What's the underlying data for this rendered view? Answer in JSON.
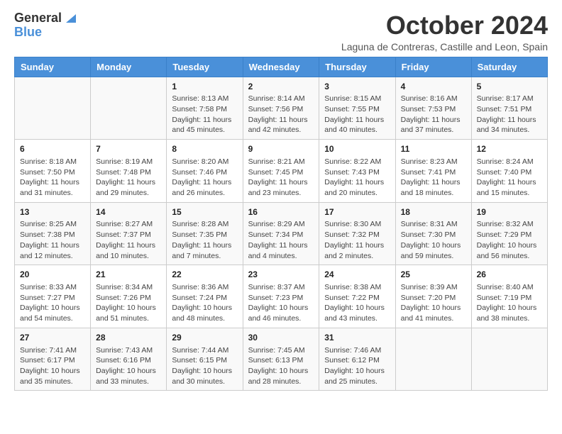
{
  "header": {
    "logo_line1": "General",
    "logo_line2": "Blue",
    "month_title": "October 2024",
    "location": "Laguna de Contreras, Castille and Leon, Spain"
  },
  "weekdays": [
    "Sunday",
    "Monday",
    "Tuesday",
    "Wednesday",
    "Thursday",
    "Friday",
    "Saturday"
  ],
  "weeks": [
    [
      {
        "day": "",
        "content": ""
      },
      {
        "day": "",
        "content": ""
      },
      {
        "day": "1",
        "content": "Sunrise: 8:13 AM\nSunset: 7:58 PM\nDaylight: 11 hours and 45 minutes."
      },
      {
        "day": "2",
        "content": "Sunrise: 8:14 AM\nSunset: 7:56 PM\nDaylight: 11 hours and 42 minutes."
      },
      {
        "day": "3",
        "content": "Sunrise: 8:15 AM\nSunset: 7:55 PM\nDaylight: 11 hours and 40 minutes."
      },
      {
        "day": "4",
        "content": "Sunrise: 8:16 AM\nSunset: 7:53 PM\nDaylight: 11 hours and 37 minutes."
      },
      {
        "day": "5",
        "content": "Sunrise: 8:17 AM\nSunset: 7:51 PM\nDaylight: 11 hours and 34 minutes."
      }
    ],
    [
      {
        "day": "6",
        "content": "Sunrise: 8:18 AM\nSunset: 7:50 PM\nDaylight: 11 hours and 31 minutes."
      },
      {
        "day": "7",
        "content": "Sunrise: 8:19 AM\nSunset: 7:48 PM\nDaylight: 11 hours and 29 minutes."
      },
      {
        "day": "8",
        "content": "Sunrise: 8:20 AM\nSunset: 7:46 PM\nDaylight: 11 hours and 26 minutes."
      },
      {
        "day": "9",
        "content": "Sunrise: 8:21 AM\nSunset: 7:45 PM\nDaylight: 11 hours and 23 minutes."
      },
      {
        "day": "10",
        "content": "Sunrise: 8:22 AM\nSunset: 7:43 PM\nDaylight: 11 hours and 20 minutes."
      },
      {
        "day": "11",
        "content": "Sunrise: 8:23 AM\nSunset: 7:41 PM\nDaylight: 11 hours and 18 minutes."
      },
      {
        "day": "12",
        "content": "Sunrise: 8:24 AM\nSunset: 7:40 PM\nDaylight: 11 hours and 15 minutes."
      }
    ],
    [
      {
        "day": "13",
        "content": "Sunrise: 8:25 AM\nSunset: 7:38 PM\nDaylight: 11 hours and 12 minutes."
      },
      {
        "day": "14",
        "content": "Sunrise: 8:27 AM\nSunset: 7:37 PM\nDaylight: 11 hours and 10 minutes."
      },
      {
        "day": "15",
        "content": "Sunrise: 8:28 AM\nSunset: 7:35 PM\nDaylight: 11 hours and 7 minutes."
      },
      {
        "day": "16",
        "content": "Sunrise: 8:29 AM\nSunset: 7:34 PM\nDaylight: 11 hours and 4 minutes."
      },
      {
        "day": "17",
        "content": "Sunrise: 8:30 AM\nSunset: 7:32 PM\nDaylight: 11 hours and 2 minutes."
      },
      {
        "day": "18",
        "content": "Sunrise: 8:31 AM\nSunset: 7:30 PM\nDaylight: 10 hours and 59 minutes."
      },
      {
        "day": "19",
        "content": "Sunrise: 8:32 AM\nSunset: 7:29 PM\nDaylight: 10 hours and 56 minutes."
      }
    ],
    [
      {
        "day": "20",
        "content": "Sunrise: 8:33 AM\nSunset: 7:27 PM\nDaylight: 10 hours and 54 minutes."
      },
      {
        "day": "21",
        "content": "Sunrise: 8:34 AM\nSunset: 7:26 PM\nDaylight: 10 hours and 51 minutes."
      },
      {
        "day": "22",
        "content": "Sunrise: 8:36 AM\nSunset: 7:24 PM\nDaylight: 10 hours and 48 minutes."
      },
      {
        "day": "23",
        "content": "Sunrise: 8:37 AM\nSunset: 7:23 PM\nDaylight: 10 hours and 46 minutes."
      },
      {
        "day": "24",
        "content": "Sunrise: 8:38 AM\nSunset: 7:22 PM\nDaylight: 10 hours and 43 minutes."
      },
      {
        "day": "25",
        "content": "Sunrise: 8:39 AM\nSunset: 7:20 PM\nDaylight: 10 hours and 41 minutes."
      },
      {
        "day": "26",
        "content": "Sunrise: 8:40 AM\nSunset: 7:19 PM\nDaylight: 10 hours and 38 minutes."
      }
    ],
    [
      {
        "day": "27",
        "content": "Sunrise: 7:41 AM\nSunset: 6:17 PM\nDaylight: 10 hours and 35 minutes."
      },
      {
        "day": "28",
        "content": "Sunrise: 7:43 AM\nSunset: 6:16 PM\nDaylight: 10 hours and 33 minutes."
      },
      {
        "day": "29",
        "content": "Sunrise: 7:44 AM\nSunset: 6:15 PM\nDaylight: 10 hours and 30 minutes."
      },
      {
        "day": "30",
        "content": "Sunrise: 7:45 AM\nSunset: 6:13 PM\nDaylight: 10 hours and 28 minutes."
      },
      {
        "day": "31",
        "content": "Sunrise: 7:46 AM\nSunset: 6:12 PM\nDaylight: 10 hours and 25 minutes."
      },
      {
        "day": "",
        "content": ""
      },
      {
        "day": "",
        "content": ""
      }
    ]
  ]
}
